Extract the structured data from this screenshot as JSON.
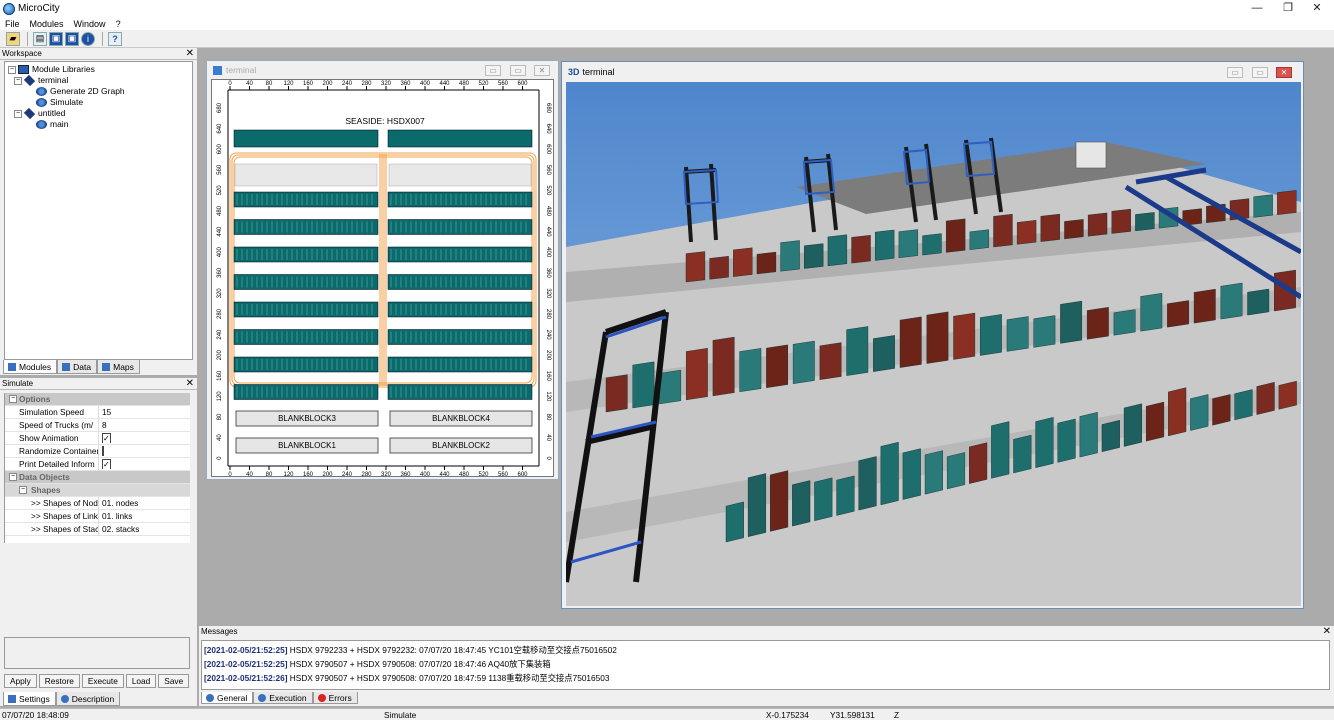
{
  "app": {
    "title": "MicroCity"
  },
  "menu": [
    "File",
    "Modules",
    "Window",
    "?"
  ],
  "workspace": {
    "title": "Workspace",
    "tree": {
      "root": "Module Libraries",
      "terminal": "terminal",
      "gen": "Generate 2D Graph",
      "sim": "Simulate",
      "untitled": "untitled",
      "main": "main"
    },
    "tabs": [
      "Modules",
      "Data",
      "Maps"
    ]
  },
  "simulate": {
    "title": "Simulate",
    "options_label": "Options",
    "rows": [
      {
        "name": "Simulation Speed",
        "value": "15"
      },
      {
        "name": "Speed of Trucks (m/",
        "value": "8"
      },
      {
        "name": "Show Animation",
        "check": "✓"
      },
      {
        "name": "Randomize Containers",
        "check": ""
      },
      {
        "name": "Print Detailed Inform",
        "check": "✓"
      }
    ],
    "data_objects_label": "Data Objects",
    "shapes_label": "Shapes",
    "shapes": [
      {
        "name": ">> Shapes of Nodes",
        "value": "01. nodes"
      },
      {
        "name": ">> Shapes of Links",
        "value": "01. links"
      },
      {
        "name": ">> Shapes of Stacks",
        "value": "02. stacks"
      }
    ],
    "buttons": [
      "Apply",
      "Restore",
      "Execute",
      "Load",
      "Save"
    ],
    "tabs": [
      "Settings",
      "Description"
    ]
  },
  "win2d": {
    "title": "terminal",
    "seaside": "SEASIDE: HSDX007",
    "x_ticks": [
      "0",
      "40",
      "80",
      "120",
      "160",
      "200",
      "240",
      "280",
      "320",
      "360",
      "400",
      "440",
      "480",
      "520",
      "560",
      "600"
    ],
    "y_ticks": [
      "680",
      "640",
      "600",
      "560",
      "520",
      "480",
      "440",
      "400",
      "360",
      "320",
      "280",
      "240",
      "200",
      "160",
      "120",
      "80",
      "40",
      "0"
    ],
    "blocks": [
      "BLANKBLOCK3",
      "BLANKBLOCK4",
      "BLANKBLOCK1",
      "BLANKBLOCK2"
    ]
  },
  "win3d": {
    "badge": "3D",
    "title": "terminal"
  },
  "messages": {
    "title": "Messages",
    "items": [
      {
        "ts": "[2021-02-05/21:52:25]",
        "text": " HSDX 9792233 + HSDX 9792232: 07/07/20 18:47:45 YC101空载移动至交接点75016502"
      },
      {
        "ts": "[2021-02-05/21:52:25]",
        "text": " HSDX 9790507 + HSDX 9790508: 07/07/20 18:47:46 AQ40放下集装箱"
      },
      {
        "ts": "[2021-02-05/21:52:26]",
        "text": " HSDX 9790507 + HSDX 9790508: 07/07/20 18:47:59 1138重载移动至交接点75016503"
      }
    ],
    "tabs": [
      "General",
      "Execution",
      "Errors"
    ]
  },
  "status": {
    "time": "07/07/20 18:48:09",
    "module": "Simulate",
    "x": "X-0.175234",
    "y": "Y31.598131",
    "z": "Z"
  }
}
